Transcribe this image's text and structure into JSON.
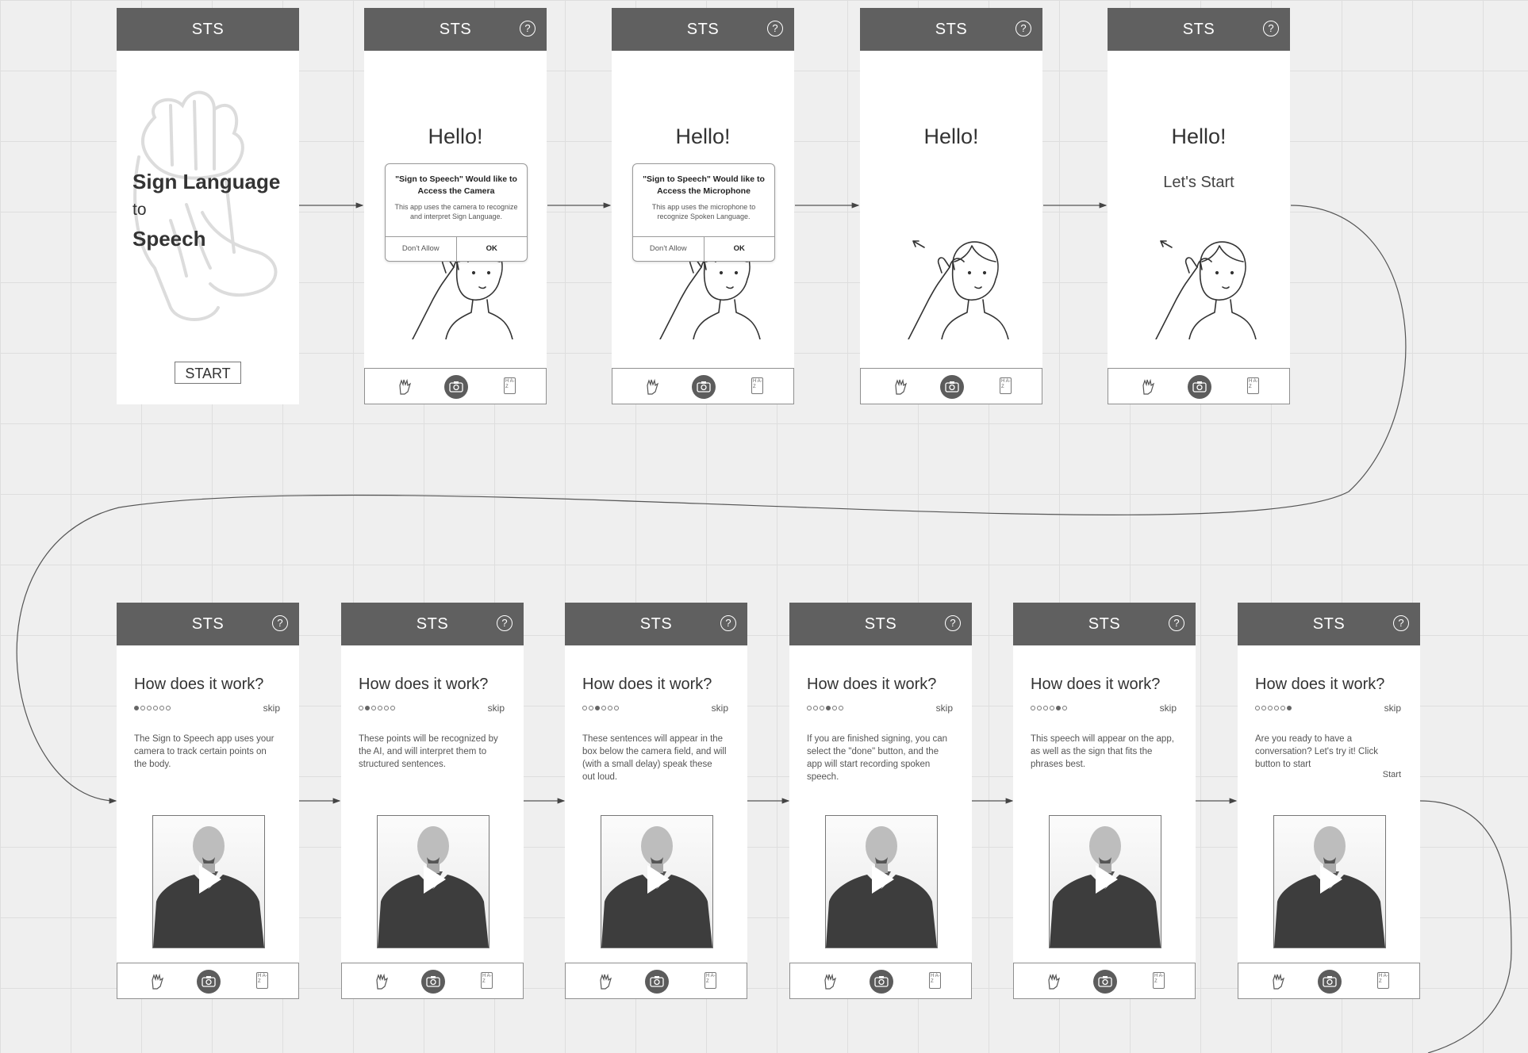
{
  "app_title": "STS",
  "help_label": "?",
  "splash": {
    "title_line1": "Sign Language",
    "title_line2": "to",
    "title_line3": "Speech",
    "start_label": "START"
  },
  "permission_camera": {
    "hello": "Hello!",
    "title": "\"Sign to Speech\" Would like to Access the Camera",
    "body": "This app uses the camera to recognize and interpret Sign Language.",
    "deny": "Don't Allow",
    "ok": "OK"
  },
  "permission_mic": {
    "hello": "Hello!",
    "title": "\"Sign to Speech\" Would like to Access the Microphone",
    "body": "This app uses the microphone to recognize Spoken Language.",
    "deny": "Don't Allow",
    "ok": "OK"
  },
  "hello_screen": {
    "hello": "Hello!"
  },
  "start_screen": {
    "hello": "Hello!",
    "sub": "Let's Start"
  },
  "nav": {
    "dictionary_label": "H  A-Z"
  },
  "how": {
    "title": "How does it work?",
    "skip": "skip",
    "start_link": "Start",
    "steps": [
      "The Sign to Speech app uses your camera to track certain points on the body.",
      "These points will be recognized by the AI, and will interpret them to structured sentences.",
      "These sentences will appear in the box below the camera field, and will (with a small delay) speak these out loud.",
      "If you are finished signing, you can select the \"done\" button, and the app will start recording spoken speech.",
      "This speech will appear on the app, as well as the sign that fits the phrases best.",
      "Are you ready to have a conversation? Let's try it! Click button to start"
    ]
  },
  "icons": {
    "help": "help-icon",
    "hand": "hand-sign-icon",
    "camera": "camera-icon",
    "dictionary": "dictionary-icon",
    "play": "play-icon"
  },
  "colors": {
    "header": "#606060",
    "canvas": "#efefef",
    "connector": "#555555"
  }
}
